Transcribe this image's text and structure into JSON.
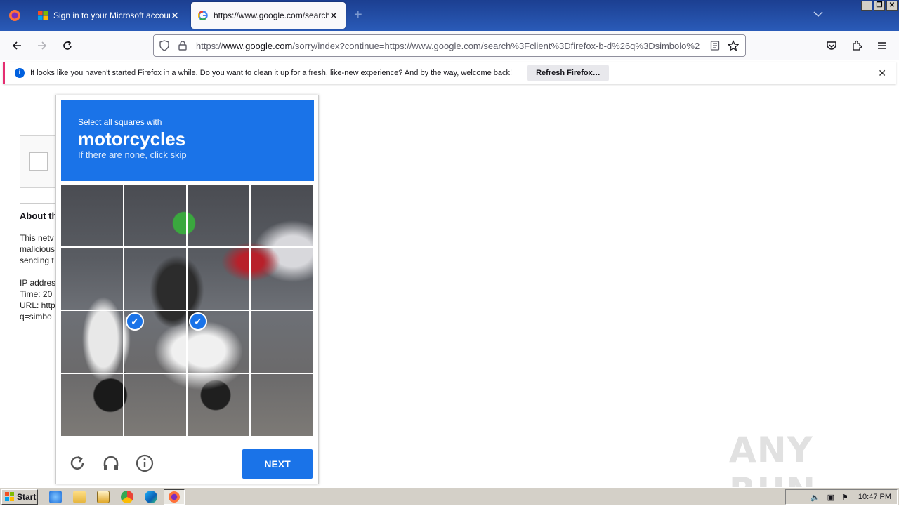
{
  "browser": {
    "tabs": [
      {
        "label": "Sign in to your Microsoft account",
        "icon": "microsoft-icon",
        "active": false
      },
      {
        "label": "https://www.google.com/search?c",
        "icon": "google-icon",
        "active": true
      }
    ],
    "url": {
      "prefix": "https://",
      "host": "www.google.com",
      "path": "/sorry/index?continue=https://www.google.com/search%3Fclient%3Dfirefox-b-d%26q%3Dsimbolo%2"
    },
    "notification": {
      "text": "It looks like you haven't started Firefox in a while. Do you want to clean it up for a fresh, like-new experience? And by the way, welcome back!",
      "button": "Refresh Firefox…"
    }
  },
  "page": {
    "about_heading": "About th",
    "para1": [
      "This netv",
      "malicious",
      "sending t"
    ],
    "para2": [
      "IP addres",
      "Time: 20",
      "URL: http",
      "q=simbo"
    ]
  },
  "challenge": {
    "line1": "Select all squares with",
    "target": "motorcycles",
    "line3": "If there are none, click skip",
    "selected_tiles": [
      9,
      10
    ],
    "next_label": "NEXT"
  },
  "watermark": "ANY RUN",
  "taskbar": {
    "start_label": "Start",
    "clock": "10:47 PM"
  }
}
